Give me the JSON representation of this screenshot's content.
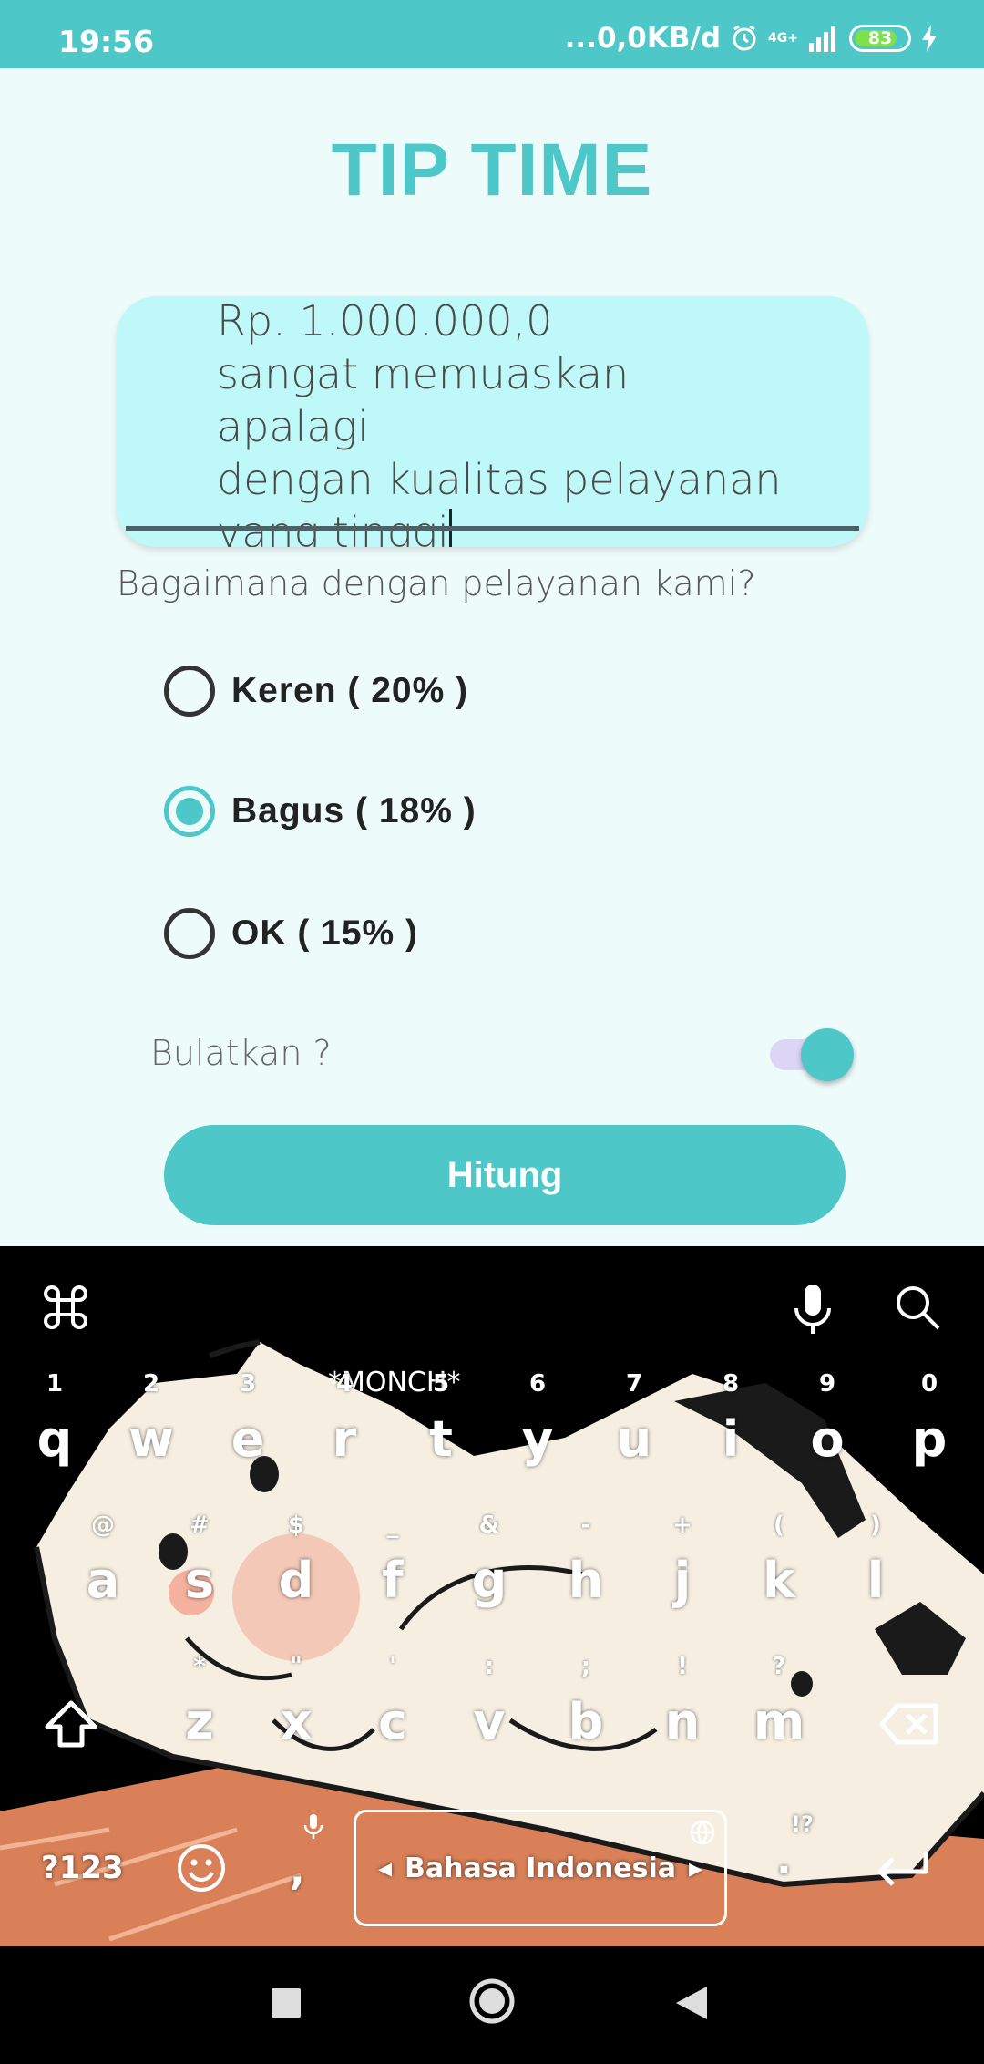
{
  "status_bar": {
    "time": "19:56",
    "network_speed": "...0,0KB/d",
    "network_type": "4G+",
    "battery": "83"
  },
  "app": {
    "title": "TIP TIME",
    "input_text": "Rp. 1.000.000,0\nsangat memuaskan apalagi\ndengan kualitas pelayanan\nyang tinggi",
    "question": "Bagaimana dengan pelayanan kami?",
    "options": [
      {
        "label": "Keren ( 20% )",
        "checked": false
      },
      {
        "label": "Bagus ( 18% )",
        "checked": true
      },
      {
        "label": "OK ( 15% )",
        "checked": false
      }
    ],
    "round_label": "Bulatkan ?",
    "round_enabled": true,
    "calculate_label": "Hitung",
    "accent_color": "#4dc7c7"
  },
  "keyboard": {
    "row1": [
      {
        "key": "q",
        "hint": "1"
      },
      {
        "key": "w",
        "hint": "2"
      },
      {
        "key": "e",
        "hint": "3"
      },
      {
        "key": "r",
        "hint": "4"
      },
      {
        "key": "t",
        "hint": "5"
      },
      {
        "key": "y",
        "hint": "6"
      },
      {
        "key": "u",
        "hint": "7"
      },
      {
        "key": "i",
        "hint": "8"
      },
      {
        "key": "o",
        "hint": "9"
      },
      {
        "key": "p",
        "hint": "0"
      }
    ],
    "row2": [
      {
        "key": "a",
        "hint": "@"
      },
      {
        "key": "s",
        "hint": "#"
      },
      {
        "key": "d",
        "hint": "$"
      },
      {
        "key": "f",
        "hint": "_"
      },
      {
        "key": "g",
        "hint": "&"
      },
      {
        "key": "h",
        "hint": "-"
      },
      {
        "key": "j",
        "hint": "+"
      },
      {
        "key": "k",
        "hint": "("
      },
      {
        "key": "l",
        "hint": ")"
      }
    ],
    "row3": [
      {
        "key": "z",
        "hint": "*"
      },
      {
        "key": "x",
        "hint": "\""
      },
      {
        "key": "c",
        "hint": "'"
      },
      {
        "key": "v",
        "hint": ":"
      },
      {
        "key": "b",
        "hint": ";"
      },
      {
        "key": "n",
        "hint": "!"
      },
      {
        "key": "m",
        "hint": "?"
      }
    ],
    "symbols_key": "?123",
    "comma_key": ",",
    "period_key": ".",
    "period_hint": "!?",
    "space_label": "Bahasa Indonesia",
    "theme_text": "*MONCH*",
    "icons": [
      "command-icon",
      "mic-icon",
      "search-icon",
      "shift-icon",
      "backspace-icon",
      "emoji-icon",
      "enter-icon",
      "globe-icon"
    ]
  },
  "nav": {
    "icons": [
      "recents-icon",
      "home-icon",
      "back-icon"
    ]
  }
}
